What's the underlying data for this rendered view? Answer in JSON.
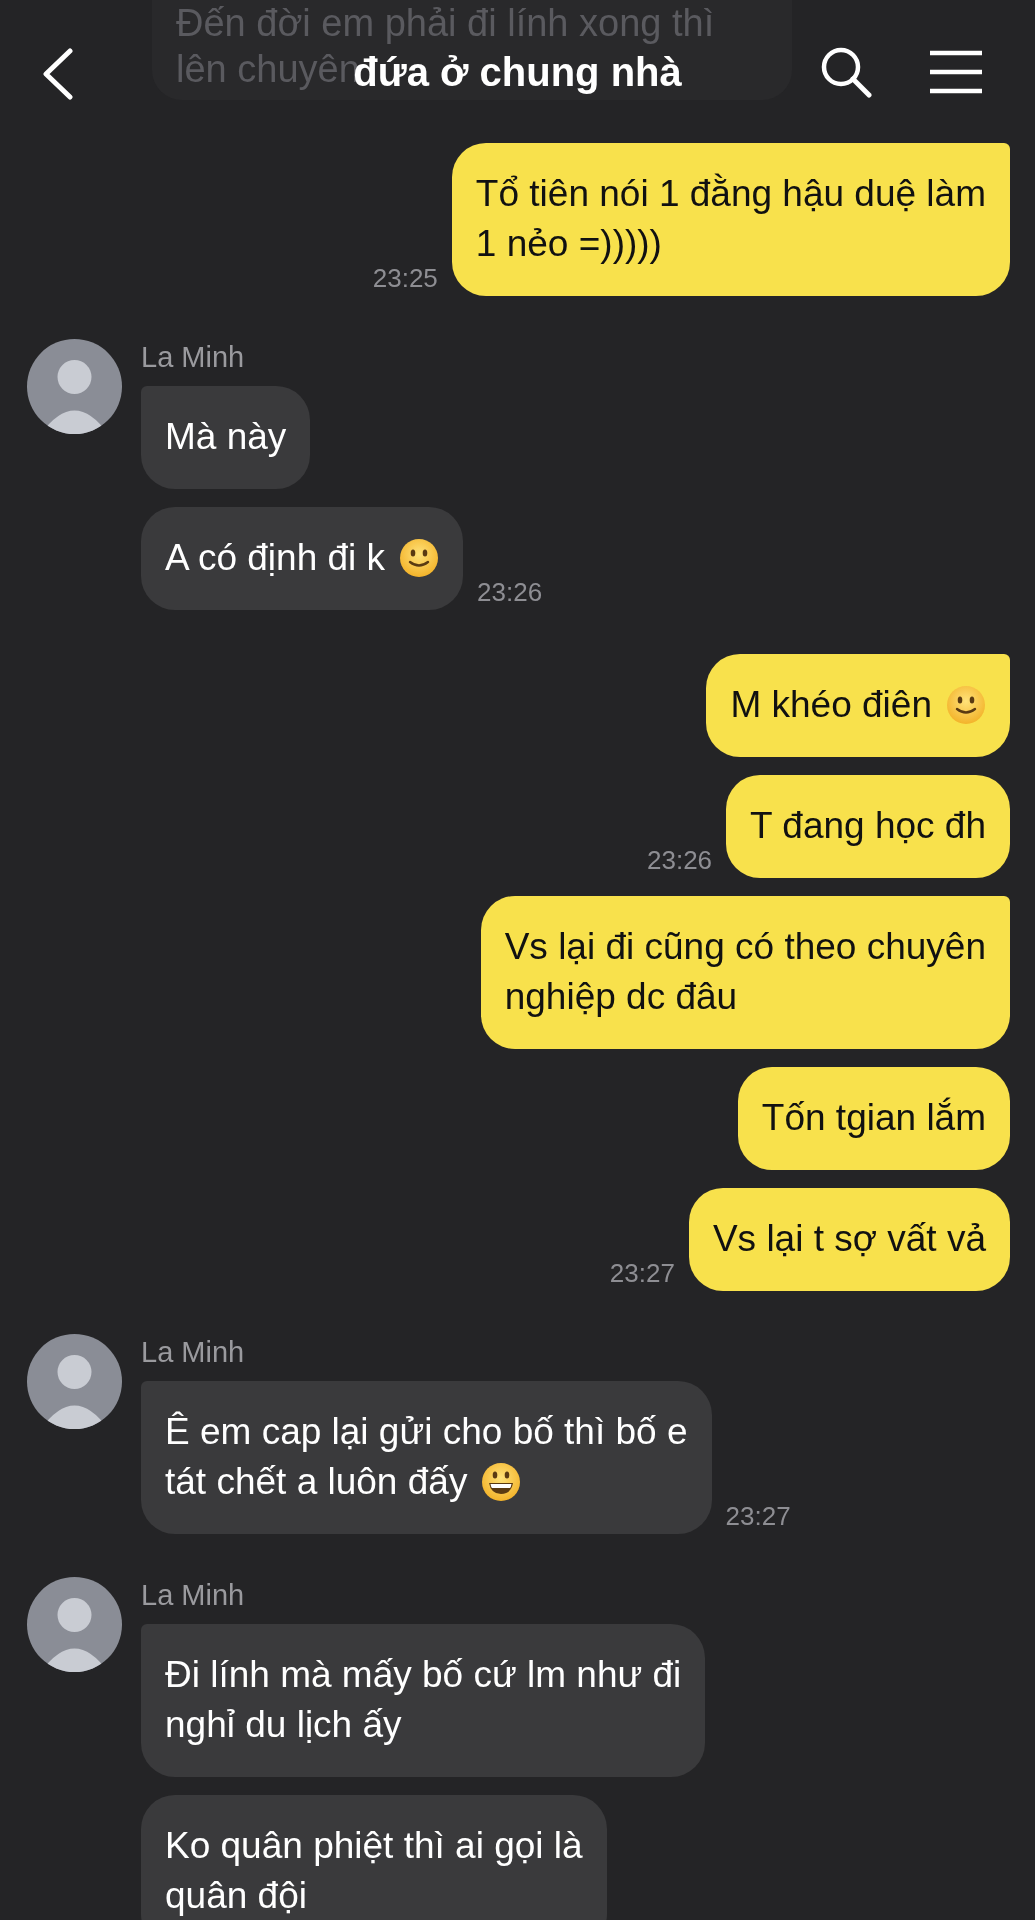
{
  "header": {
    "title": "đứa ở chung nhà"
  },
  "faded_message": {
    "lines": [
      "Đến đời em phải đi lính xong thì",
      "lên chuyên"
    ]
  },
  "groups": [
    {
      "kind": "outgoing",
      "time": "23:25",
      "messages": [
        {
          "kind": "plain",
          "text": "Tổ tiên nói 1 đằng hậu duệ làm\n1 nẻo =)))))"
        }
      ]
    },
    {
      "kind": "incoming",
      "name": "La Minh",
      "time": "23:26",
      "messages": [
        {
          "kind": "plain",
          "text": "Mà này"
        },
        {
          "kind": "smile",
          "text": "A có định đi k"
        }
      ]
    },
    {
      "kind": "outgoing",
      "time": "23:26",
      "messages": [
        {
          "kind": "smile",
          "text": "M khéo điên"
        },
        {
          "kind": "plain",
          "text": "T đang học đh"
        }
      ]
    },
    {
      "kind": "outgoing",
      "time": "23:27",
      "messages": [
        {
          "kind": "plain",
          "text": "Vs lại đi cũng có theo chuyên\nnghiệp dc đâu"
        },
        {
          "kind": "plain",
          "text": "Tốn tgian lắm"
        },
        {
          "kind": "plain",
          "text": "Vs lại t sợ vất vả"
        }
      ]
    },
    {
      "kind": "incoming",
      "name": "La Minh",
      "time": "23:27",
      "messages": [
        {
          "kind": "grin",
          "text": "Ê em cap lại gửi cho bố thì bố e\ntát chết a luôn đấy"
        }
      ]
    },
    {
      "kind": "incoming",
      "name": "La Minh",
      "messages": [
        {
          "kind": "plain",
          "text": "Đi lính mà mấy bố cứ lm như đi\nnghỉ du lịch ấy"
        },
        {
          "kind": "plain",
          "text": "Ko quân phiệt thì ai gọi là\nquân đội"
        }
      ]
    }
  ]
}
